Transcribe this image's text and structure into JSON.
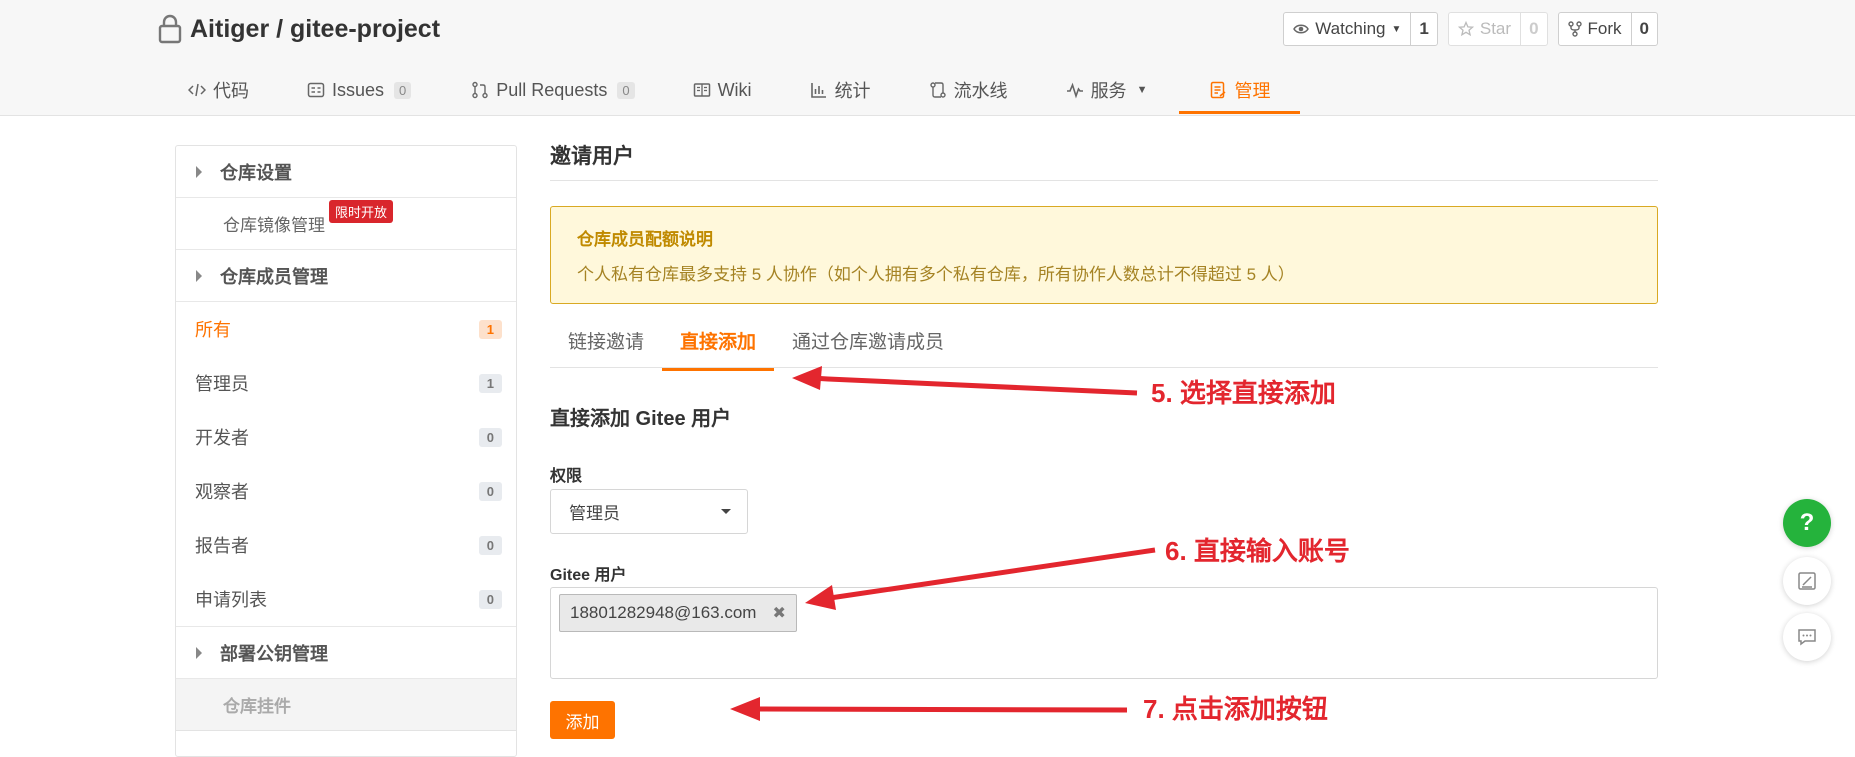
{
  "repo": {
    "title": "Aitiger / gitee-project"
  },
  "actions": [
    {
      "label": "Watching",
      "count": "1"
    },
    {
      "label": "Star",
      "count": "0"
    },
    {
      "label": "Fork",
      "count": "0"
    }
  ],
  "nav": [
    {
      "label": "代码"
    },
    {
      "label": "Issues",
      "badge": "0"
    },
    {
      "label": "Pull Requests",
      "badge": "0"
    },
    {
      "label": "Wiki"
    },
    {
      "label": "统计"
    },
    {
      "label": "流水线"
    },
    {
      "label": "服务"
    },
    {
      "label": "管理"
    }
  ],
  "sidebar": {
    "repo_settings": "仓库设置",
    "mirror": "仓库镜像管理",
    "ribbon": "限时开放",
    "members": "仓库成员管理",
    "items": [
      {
        "label": "所有",
        "count": "1"
      },
      {
        "label": "管理员",
        "count": "1"
      },
      {
        "label": "开发者",
        "count": "0"
      },
      {
        "label": "观察者",
        "count": "0"
      },
      {
        "label": "报告者",
        "count": "0"
      },
      {
        "label": "申请列表",
        "count": "0"
      }
    ],
    "deploy_keys": "部署公钥管理",
    "plugins": "仓库挂件"
  },
  "main": {
    "title": "邀请用户",
    "notice_title": "仓库成员配额说明",
    "notice_text": "个人私有仓库最多支持 5 人协作（如个人拥有多个私有仓库，所有协作人数总计不得超过 5 人）",
    "tabs": [
      "链接邀请",
      "直接添加",
      "通过仓库邀请成员"
    ],
    "section_title": "直接添加 Gitee 用户",
    "permission_label": "权限",
    "permission_value": "管理员",
    "user_label": "Gitee 用户",
    "user_chip": "18801282948@163.com",
    "add_button": "添加"
  },
  "annotations": {
    "step5": "5. 选择直接添加",
    "step6": "6. 直接输入账号",
    "step7": "7. 点击添加按钮",
    "color": "#e3262e"
  },
  "float": {
    "help": "?"
  },
  "colors": {
    "accent": "#fe7300",
    "help": "#25b33c",
    "ribbon": "#d9262c"
  }
}
